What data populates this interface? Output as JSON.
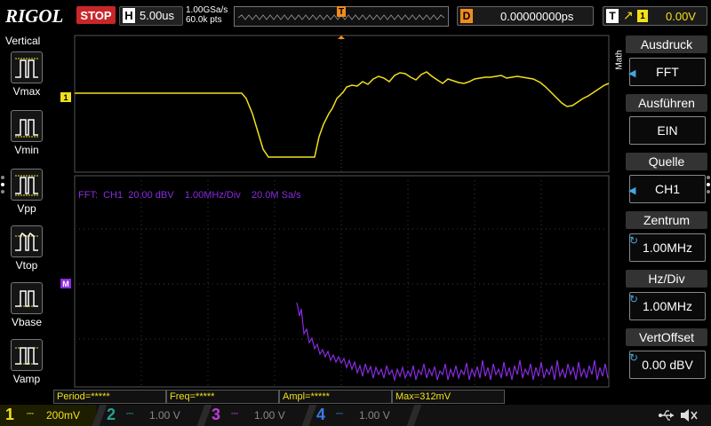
{
  "brand": "RIGOL",
  "run_state": "STOP",
  "timebase": {
    "letter": "H",
    "value": "5.00us"
  },
  "acquisition": {
    "sample_rate": "1.00GSa/s",
    "points": "60.0k pts"
  },
  "trigger_position_marker": "T",
  "delay": {
    "letter": "D",
    "value": "0.00000000ps"
  },
  "trigger": {
    "letter": "T",
    "edge_symbol": "↗",
    "source": "1",
    "level": "0.00V"
  },
  "left_panel": {
    "title": "Vertical",
    "items": [
      {
        "label": "Vmax"
      },
      {
        "label": "Vmin"
      },
      {
        "label": "Vpp"
      },
      {
        "label": "Vtop"
      },
      {
        "label": "Vbase"
      },
      {
        "label": "Vamp"
      }
    ]
  },
  "right_panel": {
    "side_label": "Math",
    "items": [
      {
        "title": "Ausdruck",
        "value": "FFT",
        "control": "arrow"
      },
      {
        "title": "Ausführen",
        "value": "EIN",
        "control": "none"
      },
      {
        "title": "Quelle",
        "value": "CH1",
        "control": "arrow"
      },
      {
        "title": "Zentrum",
        "value": "1.00MHz",
        "control": "knob"
      },
      {
        "title": "Hz/Div",
        "value": "1.00MHz",
        "control": "knob"
      },
      {
        "title": "VertOffset",
        "value": "0.00 dBV",
        "control": "knob"
      }
    ]
  },
  "fft_info": "FFT:  CH1  20.00 dBV    1.00MHz/Div    20.0M Sa/s",
  "ch1_marker": "1",
  "math_marker": "M",
  "measurements": [
    "Period=*****",
    "Freq=*****",
    "Ampl=*****",
    "Max=312mV"
  ],
  "channels": [
    {
      "num": "1",
      "coupling": "⎓",
      "scale": "200mV",
      "color": "#f2e01b",
      "active": true
    },
    {
      "num": "2",
      "coupling": "⎓",
      "scale": "1.00 V",
      "color": "#2a9f8f",
      "active": false
    },
    {
      "num": "3",
      "coupling": "⎓",
      "scale": "1.00 V",
      "color": "#c03cd8",
      "active": false
    },
    {
      "num": "4",
      "coupling": "⎓",
      "scale": "1.00 V",
      "color": "#3a7be0",
      "active": false
    }
  ],
  "colors": {
    "ch1": "#f2e01b",
    "math": "#8a2be2",
    "trigger": "#f28c1b",
    "accent": "#41a7e6"
  }
}
